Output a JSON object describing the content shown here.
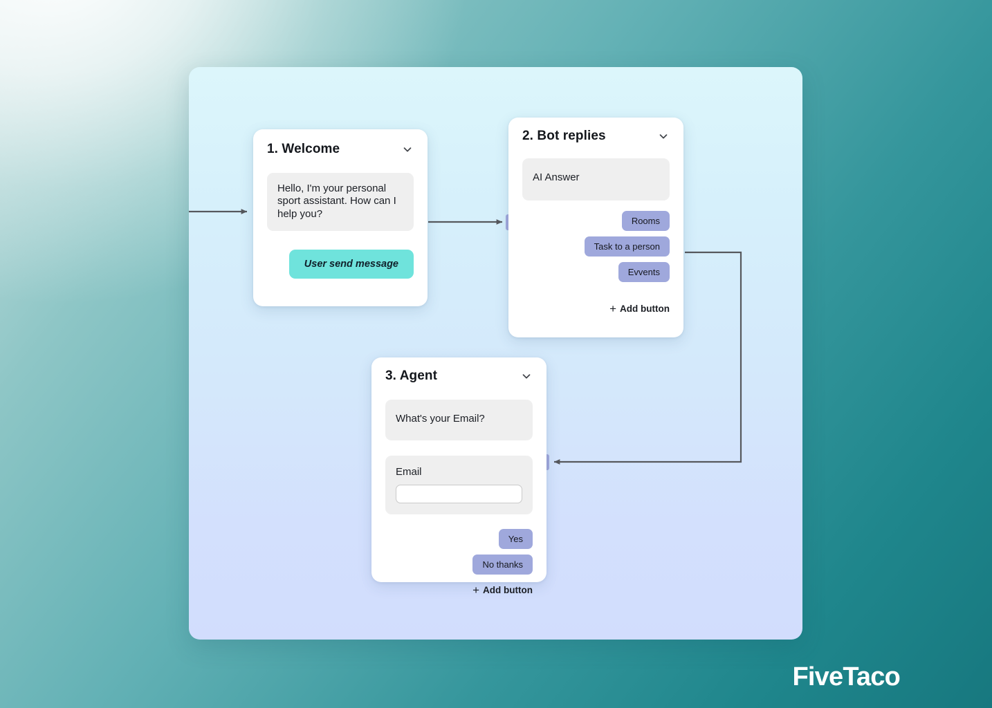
{
  "brand": {
    "logo_text": "FiveTaco"
  },
  "canvas": {
    "connectors": [
      {
        "name": "entry-to-welcome",
        "from": "canvas-left-edge",
        "to": "1. Welcome"
      },
      {
        "name": "welcome-to-bot-replies",
        "from": "1. Welcome",
        "to": "2. Bot replies"
      },
      {
        "name": "task-to-a-person-to-agent",
        "from": "Task to a person",
        "to": "3. Agent"
      }
    ]
  },
  "cards": [
    {
      "id": "welcome",
      "title": "1. Welcome",
      "collapse_icon": "chevron-down-icon",
      "message": "Hello, I'm your personal sport assistant. How can I help you?",
      "send_label": "User send message"
    },
    {
      "id": "bot-replies",
      "title": "2. Bot replies",
      "collapse_icon": "chevron-down-icon",
      "message": "AI Answer",
      "options": [
        "Rooms",
        "Task to a person",
        "Evvents"
      ],
      "add_button_label": "Add button",
      "add_button_icon": "plus-icon"
    },
    {
      "id": "agent",
      "title": "3. Agent",
      "collapse_icon": "chevron-down-icon",
      "message": "What's your Email?",
      "field": {
        "label": "Email",
        "value": "",
        "placeholder": ""
      },
      "options": [
        "Yes",
        "No thanks"
      ],
      "add_button_label": "Add button",
      "add_button_icon": "plus-icon"
    }
  ],
  "colors": {
    "background_teal": "#17787f",
    "canvas_top": "#dcf6fb",
    "canvas_bottom": "#d2ddfd",
    "option_button": "#9fa8dc",
    "send_button": "#6fe3dc",
    "bubble": "#efefef",
    "connector": "#56585c",
    "port": "#a3aadd"
  }
}
